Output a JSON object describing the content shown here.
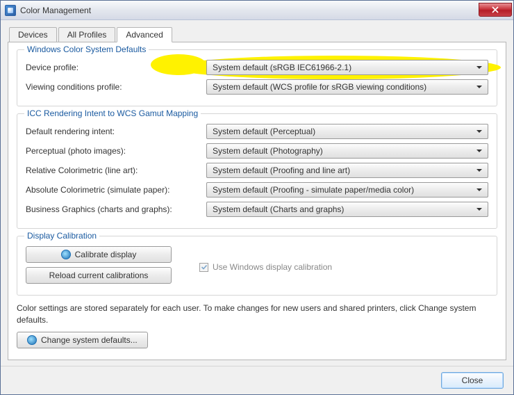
{
  "title": "Color Management",
  "tabs": [
    "Devices",
    "All Profiles",
    "Advanced"
  ],
  "activeTab": 2,
  "group_defaults": {
    "title": "Windows Color System Defaults",
    "device_profile_label": "Device profile:",
    "device_profile_value": "System default (sRGB IEC61966-2.1)",
    "viewing_label": "Viewing conditions profile:",
    "viewing_value": "System default (WCS profile for sRGB viewing conditions)"
  },
  "group_icc": {
    "title": "ICC Rendering Intent to WCS Gamut Mapping",
    "rows": [
      {
        "label": "Default rendering intent:",
        "value": "System default (Perceptual)"
      },
      {
        "label": "Perceptual (photo images):",
        "value": "System default (Photography)"
      },
      {
        "label": "Relative Colorimetric (line art):",
        "value": "System default (Proofing and line art)"
      },
      {
        "label": "Absolute Colorimetric (simulate paper):",
        "value": "System default (Proofing - simulate paper/media color)"
      },
      {
        "label": "Business Graphics (charts and graphs):",
        "value": "System default (Charts and graphs)"
      }
    ]
  },
  "group_calib": {
    "title": "Display Calibration",
    "calibrate_btn": "Calibrate display",
    "reload_btn": "Reload current calibrations",
    "chk_label": "Use Windows display calibration",
    "chk_checked": true
  },
  "note": "Color settings are stored separately for each user. To make changes for new users and shared printers, click Change system defaults.",
  "change_defaults_btn": "Change system defaults...",
  "close_btn": "Close"
}
